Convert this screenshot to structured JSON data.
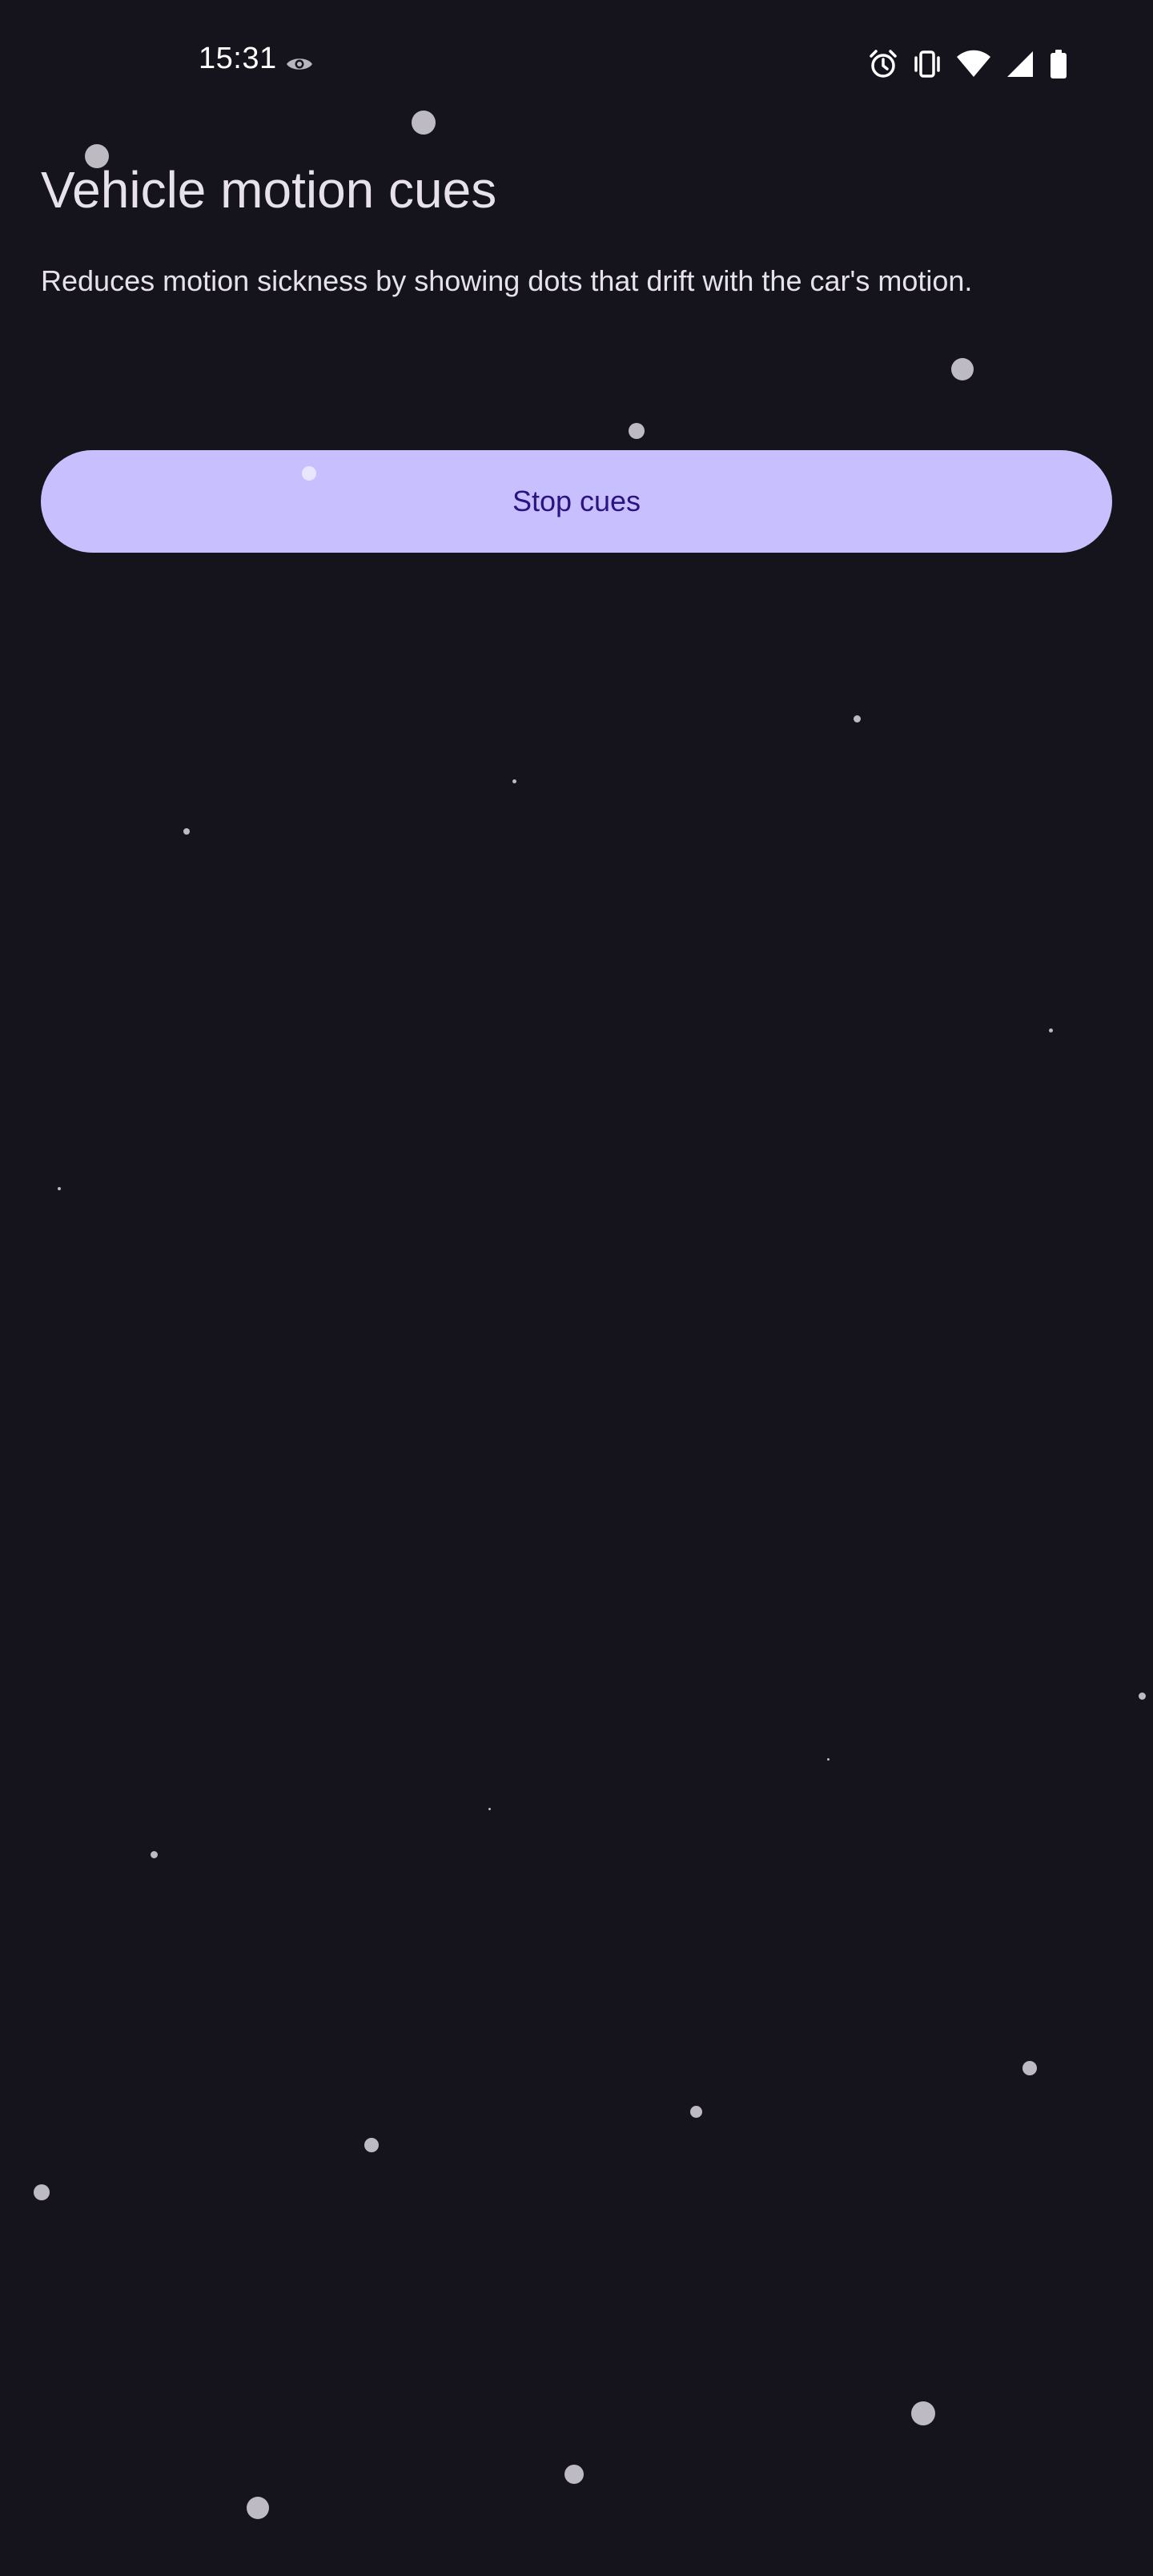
{
  "status_bar": {
    "time": "15:31",
    "icons": [
      "eye-icon",
      "alarm-icon",
      "vibrate-icon",
      "wifi-icon",
      "signal-icon",
      "battery-icon"
    ]
  },
  "main": {
    "title": "Vehicle motion cues",
    "description": "Reduces motion sickness by showing dots that drift with the car's motion.",
    "stop_button_label": "Stop cues"
  },
  "colors": {
    "background": "#15141d",
    "button": "#c8bfff",
    "button_text": "#2b1382",
    "dot": "#bdbac1"
  }
}
